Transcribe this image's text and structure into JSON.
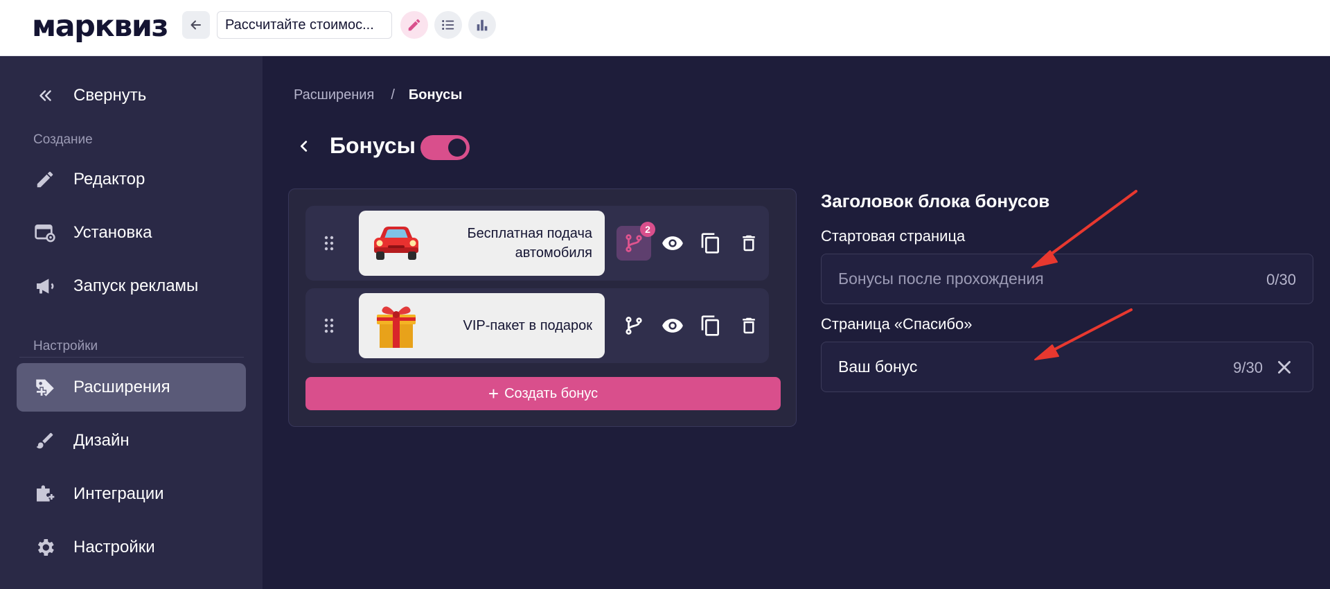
{
  "topbar": {
    "logo": "марквиз",
    "quiz_title": "Рассчитайте стоимос...",
    "accent_color": "#d94f8c"
  },
  "sidebar": {
    "collapse_label": "Свернуть",
    "section_create": "Создание",
    "section_settings": "Настройки",
    "items": [
      {
        "label": "Редактор",
        "icon": "pencil-icon"
      },
      {
        "label": "Установка",
        "icon": "install-window-icon"
      },
      {
        "label": "Запуск рекламы",
        "icon": "megaphone-icon"
      },
      {
        "label": "Расширения",
        "icon": "extensions-tag-icon",
        "active": true
      },
      {
        "label": "Дизайн",
        "icon": "brush-icon"
      },
      {
        "label": "Интеграции",
        "icon": "integrations-puzzle-icon"
      },
      {
        "label": "Настройки",
        "icon": "gear-icon"
      }
    ]
  },
  "breadcrumb": {
    "parent": "Расширения",
    "separator": "/",
    "current": "Бонусы"
  },
  "page": {
    "title": "Бонусы",
    "toggle_on": true
  },
  "bonuses": [
    {
      "title": "Бесплатная подача автомобиля",
      "emoji": "car-emoji",
      "branch_count": "2",
      "branch_active": true
    },
    {
      "title": "VIP-пакет в подарок",
      "emoji": "gift-emoji",
      "branch_active": false
    }
  ],
  "create_button": {
    "icon": "+",
    "label": "Создать бонус"
  },
  "right_panel": {
    "heading": "Заголовок блока бонусов",
    "start_label": "Стартовая страница",
    "start_placeholder": "Бонусы после прохождения",
    "start_value": "",
    "start_count": "0/30",
    "thanks_label": "Страница «Спасибо»",
    "thanks_value": "Ваш бонус",
    "thanks_count": "9/30"
  },
  "annotation_color": "#e8382f"
}
